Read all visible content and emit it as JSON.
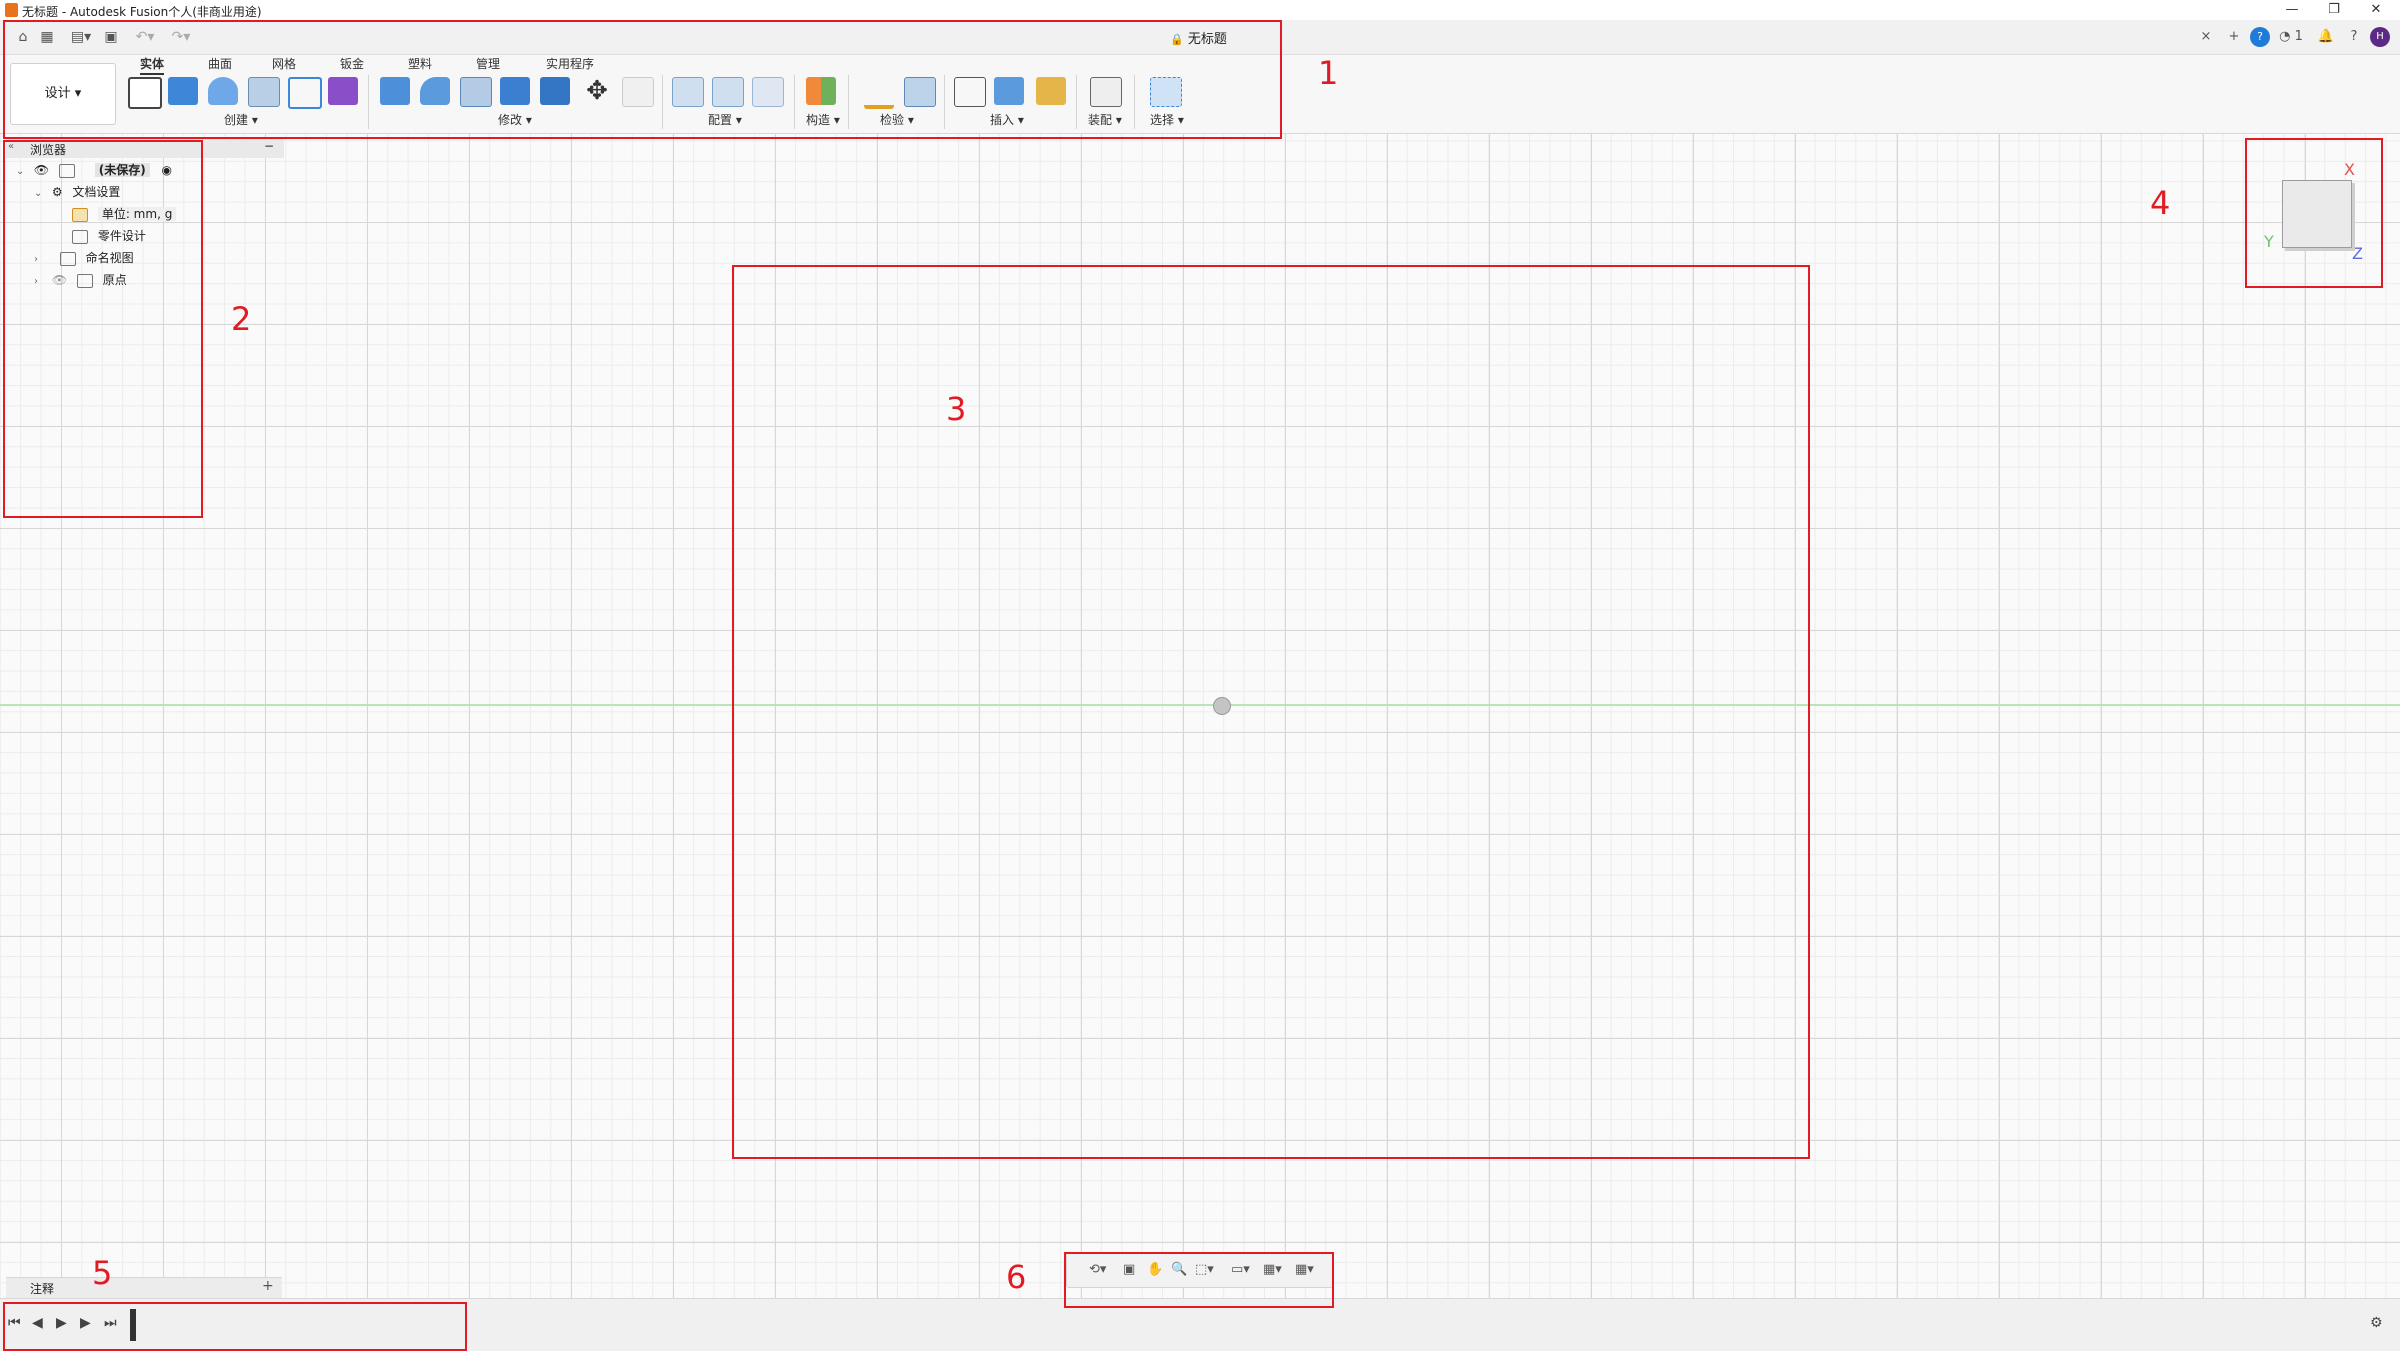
{
  "window": {
    "title": "无标题 - Autodesk Fusion个人(非商业用途)",
    "minimize_glyph": "—",
    "maximize_glyph": "❐",
    "close_glyph": "✕"
  },
  "quick_access": {
    "document_tab": "无标题",
    "lock_glyph": "🔒",
    "close_tab_glyph": "×",
    "new_tab_glyph": "+",
    "help_count": "1",
    "avatar_text": "H"
  },
  "ribbon": {
    "workspace_label": "设计",
    "tabs": [
      "实体",
      "曲面",
      "网格",
      "钣金",
      "塑料",
      "管理",
      "实用程序"
    ],
    "groups": [
      "创建",
      "修改",
      "配置",
      "构造",
      "检验",
      "插入",
      "装配",
      "选择"
    ]
  },
  "browser": {
    "header": "浏览器",
    "items": [
      {
        "label": "(未保存)"
      },
      {
        "label": "文档设置"
      },
      {
        "label": "单位: mm, g"
      },
      {
        "label": "零件设计"
      },
      {
        "label": "命名视图"
      },
      {
        "label": "原点"
      }
    ]
  },
  "viewcube": {
    "axis_x": "X",
    "axis_y": "Y",
    "axis_z": "Z"
  },
  "comments": {
    "label": "注释",
    "add_glyph": "+"
  },
  "annotations": [
    "1",
    "2",
    "3",
    "4",
    "5",
    "6"
  ],
  "colors": {
    "annotation_red": "#e01b24",
    "axis_x": "#e05050",
    "axis_y": "#70c070",
    "axis_z": "#5a6ee0"
  }
}
